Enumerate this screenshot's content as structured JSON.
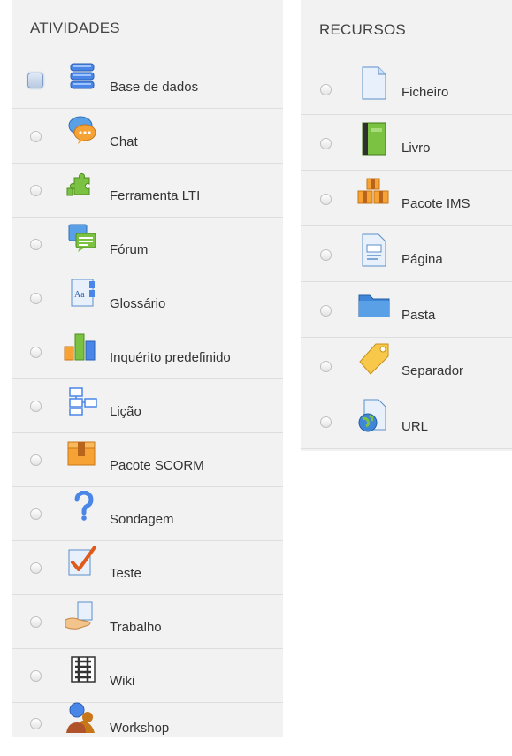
{
  "activities": {
    "title": "ATIVIDADES",
    "items": [
      {
        "label": "Base de dados",
        "icon": "database-icon",
        "selected": true
      },
      {
        "label": "Chat",
        "icon": "chat-icon",
        "selected": false
      },
      {
        "label": "Ferramenta LTI",
        "icon": "puzzle-icon",
        "selected": false
      },
      {
        "label": "Fórum",
        "icon": "forum-icon",
        "selected": false
      },
      {
        "label": "Glossário",
        "icon": "glossary-icon",
        "selected": false
      },
      {
        "label": "Inquérito predefinido",
        "icon": "survey-chart-icon",
        "selected": false
      },
      {
        "label": "Lição",
        "icon": "lesson-icon",
        "selected": false
      },
      {
        "label": "Pacote SCORM",
        "icon": "scorm-package-icon",
        "selected": false
      },
      {
        "label": "Sondagem",
        "icon": "question-mark-icon",
        "selected": false
      },
      {
        "label": "Teste",
        "icon": "quiz-check-icon",
        "selected": false
      },
      {
        "label": "Trabalho",
        "icon": "assignment-hand-icon",
        "selected": false
      },
      {
        "label": "Wiki",
        "icon": "wiki-icon",
        "selected": false
      },
      {
        "label": "Workshop",
        "icon": "workshop-people-icon",
        "selected": false
      }
    ]
  },
  "resources": {
    "title": "RECURSOS",
    "items": [
      {
        "label": "Ficheiro",
        "icon": "file-icon",
        "selected": false
      },
      {
        "label": "Livro",
        "icon": "book-icon",
        "selected": false
      },
      {
        "label": "Pacote IMS",
        "icon": "ims-package-icon",
        "selected": false
      },
      {
        "label": "Página",
        "icon": "page-icon",
        "selected": false
      },
      {
        "label": "Pasta",
        "icon": "folder-icon",
        "selected": false
      },
      {
        "label": "Separador",
        "icon": "label-tag-icon",
        "selected": false
      },
      {
        "label": "URL",
        "icon": "url-globe-icon",
        "selected": false
      }
    ]
  }
}
